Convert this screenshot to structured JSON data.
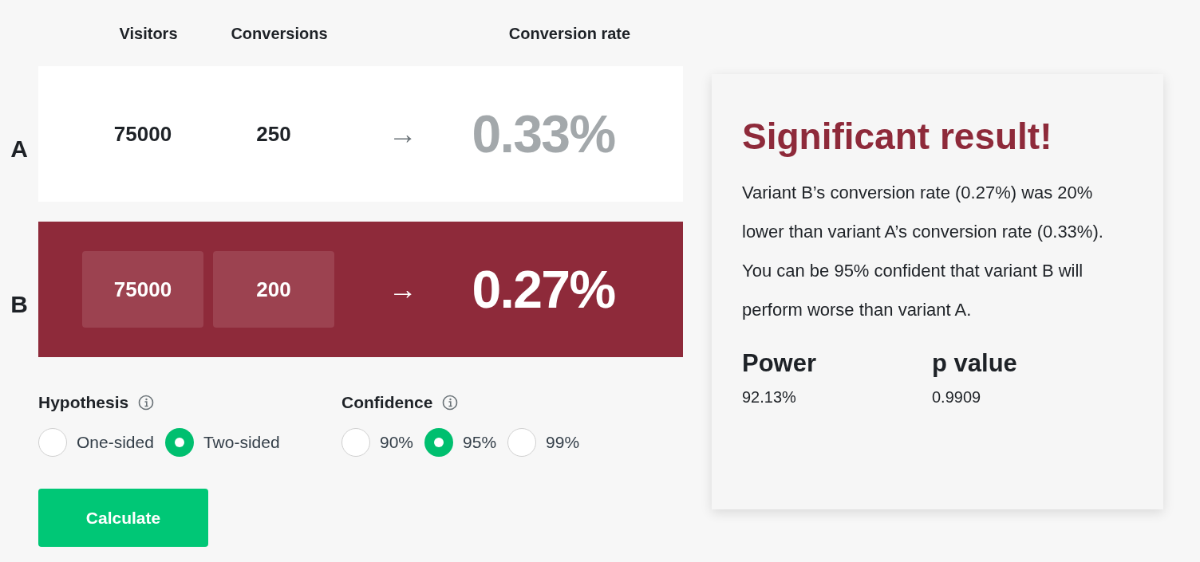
{
  "columns": [
    "Visitors",
    "Conversions",
    "Conversion rate"
  ],
  "variants": [
    {
      "label": "A",
      "visitors": "75000",
      "conversions": "250",
      "arrow": "→",
      "rate": "0.33%",
      "highlighted": false
    },
    {
      "label": "B",
      "visitors": "75000",
      "conversions": "200",
      "arrow": "→",
      "rate": "0.27%",
      "highlighted": true
    }
  ],
  "hypothesis": {
    "label": "Hypothesis",
    "options": [
      {
        "label": "One-sided",
        "selected": false
      },
      {
        "label": "Two-sided",
        "selected": true
      }
    ]
  },
  "confidence": {
    "label": "Confidence",
    "options": [
      {
        "label": "90%",
        "selected": false
      },
      {
        "label": "95%",
        "selected": true
      },
      {
        "label": "99%",
        "selected": false
      }
    ]
  },
  "calculate_button": "Calculate",
  "result": {
    "title": "Significant result!",
    "text": "Variant B’s conversion rate (0.27%) was 20% lower than variant A’s conversion rate (0.33%). You can be 95% confident that variant B will perform worse than variant A.",
    "stats": [
      {
        "label": "Power",
        "value": "92.13%"
      },
      {
        "label": "p value",
        "value": "0.9909"
      }
    ]
  }
}
